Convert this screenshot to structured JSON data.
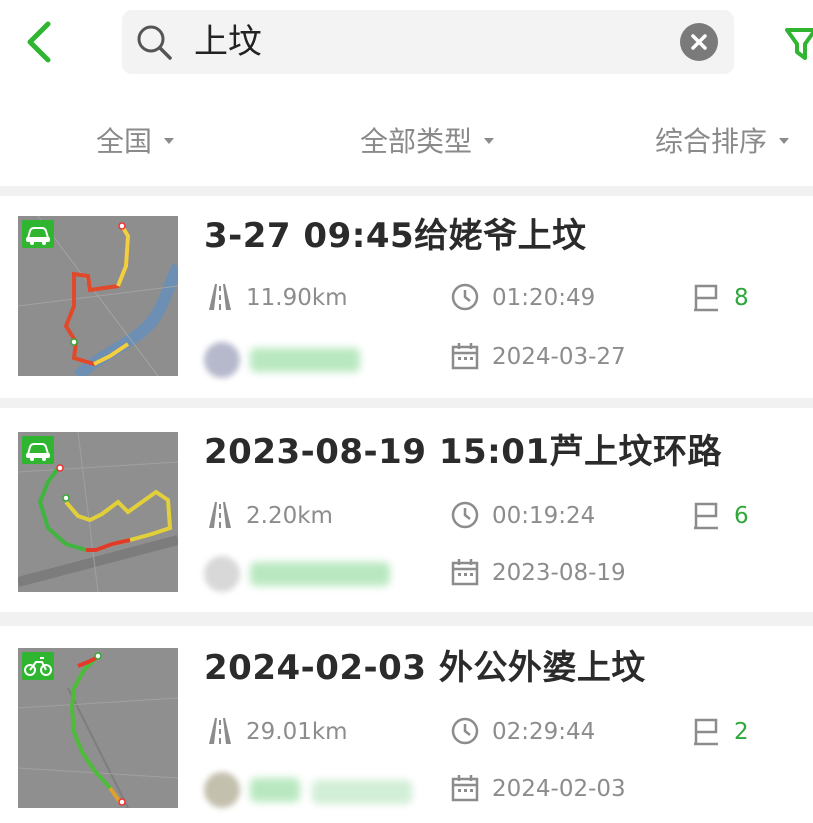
{
  "header": {
    "search_value": "上坟",
    "icons": {
      "back": "chevron-left-icon",
      "search": "magnifier-icon",
      "clear": "close-circle-icon",
      "filter": "funnel-icon"
    }
  },
  "filters": [
    {
      "label": "全国"
    },
    {
      "label": "全部类型"
    },
    {
      "label": "综合排序"
    }
  ],
  "colors": {
    "accent": "#2fb52f",
    "stat_number": "#2ea83a",
    "text_primary": "#2b2b2b",
    "text_secondary": "#8c8c8c"
  },
  "tracks": [
    {
      "title": "3-27 09:45给姥爷上坟",
      "distance": "11.90km",
      "duration": "01:20:49",
      "waypoints": "8",
      "date": "2024-03-27",
      "activity_icon": "car-icon"
    },
    {
      "title": "2023-08-19 15:01芦上坟环路",
      "distance": "2.20km",
      "duration": "00:19:24",
      "waypoints": "6",
      "date": "2023-08-19",
      "activity_icon": "car-icon"
    },
    {
      "title": "2024-02-03 外公外婆上坟",
      "distance": "29.01km",
      "duration": "02:29:44",
      "waypoints": "2",
      "date": "2024-02-03",
      "activity_icon": "motorbike-icon"
    }
  ]
}
